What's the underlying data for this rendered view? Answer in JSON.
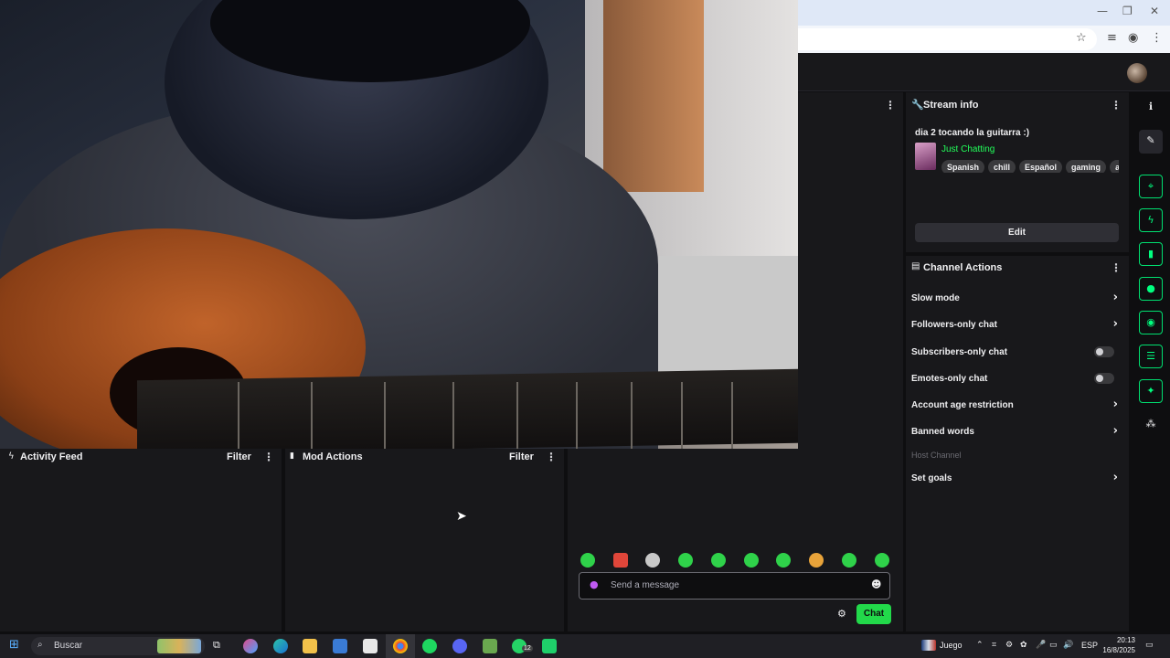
{
  "browser": {
    "window_controls": [
      "—",
      "❐",
      "✕"
    ],
    "toolbar_icons": [
      "☆",
      "≡",
      "◉",
      "⋮"
    ]
  },
  "stream_info": {
    "panel_title": "Stream info",
    "title": "dia 2 tocando la guitarra :)",
    "category": "Just Chatting",
    "tags": [
      "Spanish",
      "chill",
      "Español",
      "gaming",
      "argen"
    ],
    "edit_label": "Edit"
  },
  "channel_actions": {
    "panel_title": "Channel Actions",
    "rows": [
      {
        "label": "Slow mode",
        "control": "chevron"
      },
      {
        "label": "Followers-only chat",
        "control": "chevron"
      },
      {
        "label": "Subscribers-only chat",
        "control": "toggle"
      },
      {
        "label": "Emotes-only chat",
        "control": "toggle"
      },
      {
        "label": "Account age restriction",
        "control": "chevron"
      },
      {
        "label": "Banned words",
        "control": "chevron"
      },
      {
        "label": "Host Channel",
        "control": "none"
      },
      {
        "label": "Set goals",
        "control": "chevron"
      }
    ]
  },
  "activity_feed": {
    "title": "Activity Feed",
    "filter_label": "Filter"
  },
  "mod_actions": {
    "title": "Mod Actions",
    "filter_label": "Filter"
  },
  "chat": {
    "placeholder": "Send a message",
    "send_label": "Chat"
  },
  "colors": {
    "accent_green": "#22d94a",
    "panel_bg": "#18181b",
    "page_bg": "#0e0e10"
  },
  "taskbar": {
    "search_placeholder": "Buscar",
    "widget_label": "Juego",
    "language": "ESP",
    "time": "20:13",
    "date": "16/8/2025",
    "whatsapp_badge": "12"
  }
}
